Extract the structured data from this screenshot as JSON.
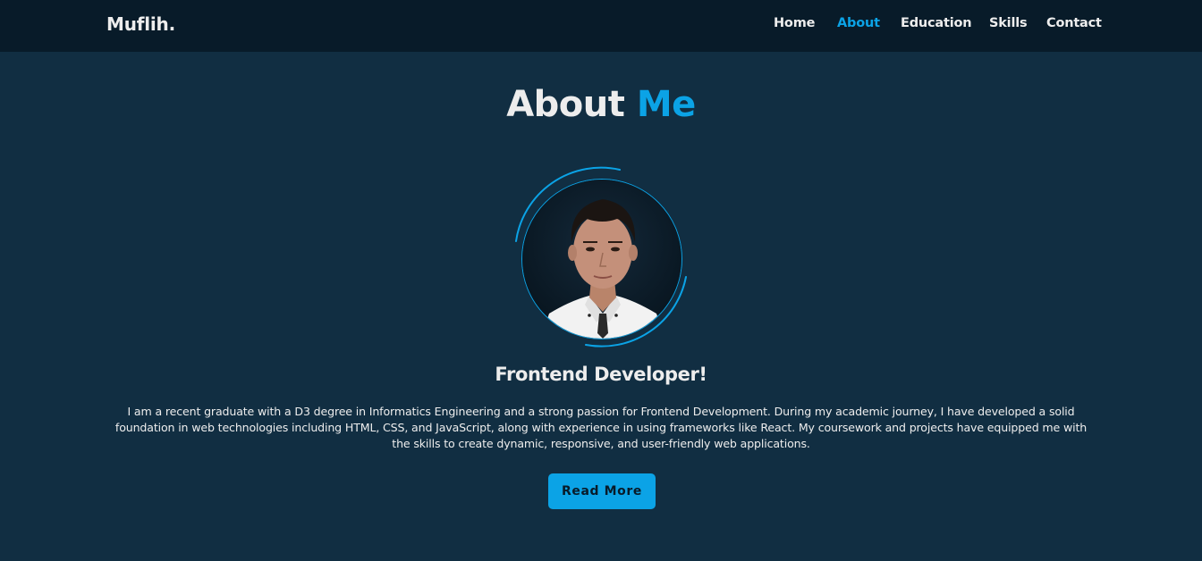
{
  "header": {
    "logo": "Muflih.",
    "nav": [
      {
        "label": "Home",
        "active": false
      },
      {
        "label": "About",
        "active": true
      },
      {
        "label": "Education",
        "active": false
      },
      {
        "label": "Skills",
        "active": false
      },
      {
        "label": "Contact",
        "active": false
      }
    ]
  },
  "about": {
    "title_main": "About",
    "title_accent": "Me",
    "role": "Frontend Developer!",
    "description": "I am a recent graduate with a D3 degree in Informatics Engineering and a strong passion for Frontend Development. During my academic journey, I have developed a solid foundation in web technologies including HTML, CSS, and JavaScript, along with experience in using frameworks like React. My coursework and projects have equipped me with the skills to create dynamic, responsive, and user-friendly web applications.",
    "button_label": "Read More"
  },
  "colors": {
    "background": "#112e42",
    "header": "#081b29",
    "accent": "#0ba3e6",
    "text": "#ededed"
  }
}
